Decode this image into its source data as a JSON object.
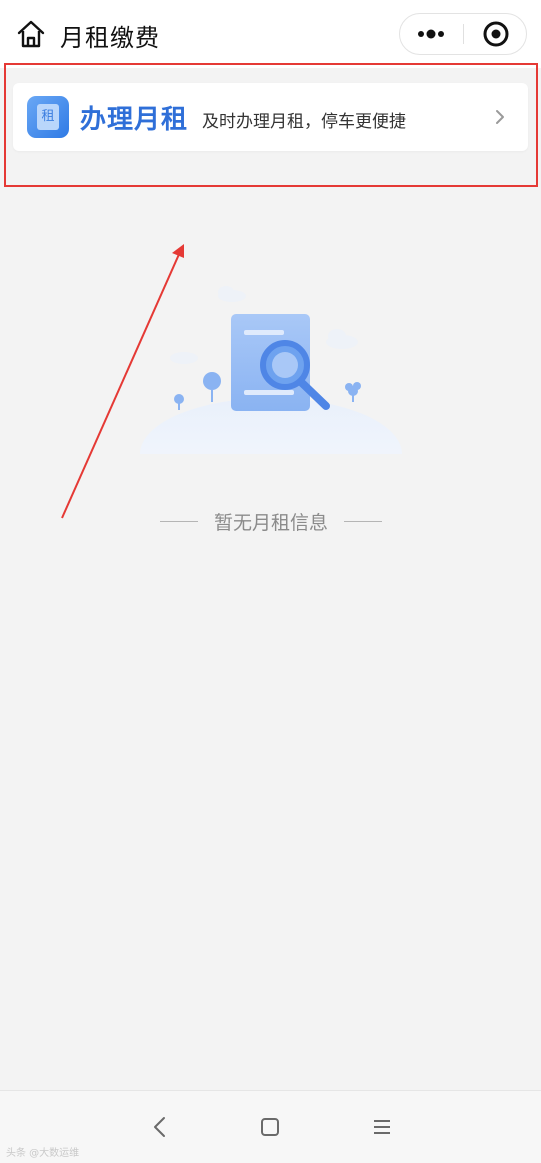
{
  "navbar": {
    "title": "月租缴费",
    "home_icon": "home-icon",
    "more_icon": "more-dots-icon",
    "close_icon": "target-close-icon"
  },
  "rent_card": {
    "icon_label": "租",
    "title": "办理月租",
    "description": "及时办理月租，停车更便捷",
    "arrow_icon": "chevron-right-icon",
    "accent_color": "#2f6fd8"
  },
  "annotation": {
    "highlight_color": "#e53935"
  },
  "empty_state": {
    "illustration": "search-document-illustration",
    "text": "暂无月租信息"
  },
  "system_nav": {
    "back_icon": "back-icon",
    "home_icon": "square-home-icon",
    "menu_icon": "menu-lines-icon"
  },
  "watermark": {
    "text": "头条 @大数运维"
  }
}
